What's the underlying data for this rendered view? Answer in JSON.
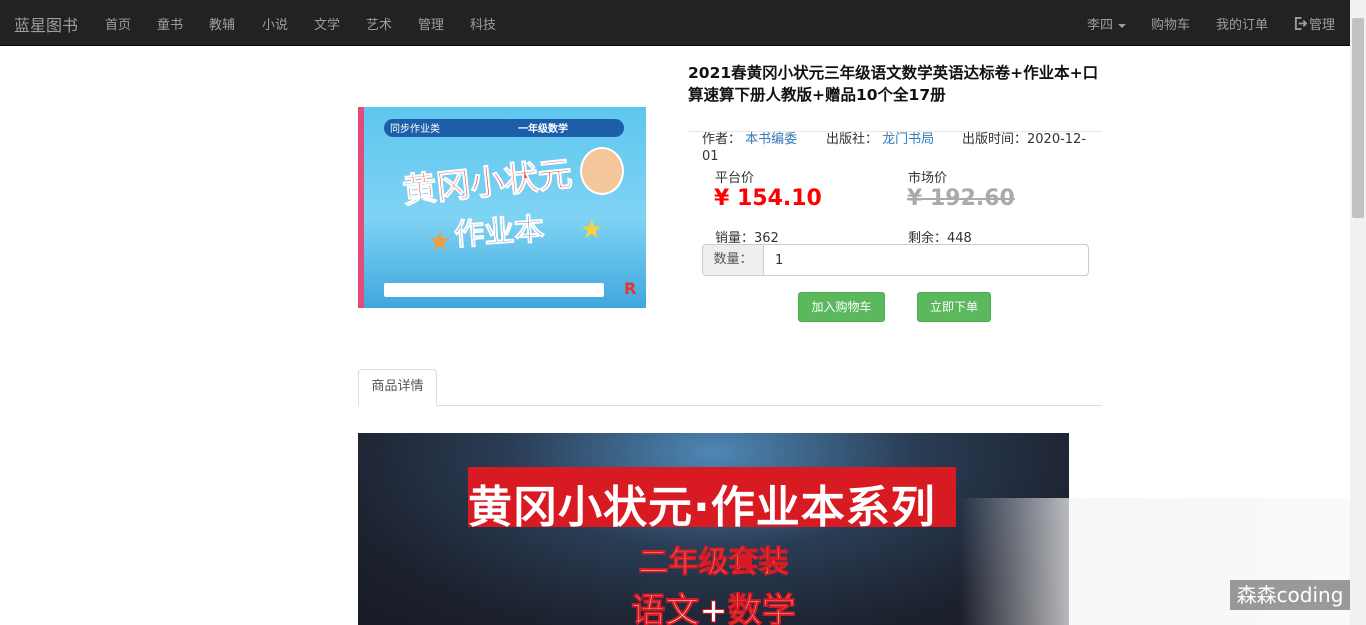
{
  "navbar": {
    "brand": "蓝星图书",
    "items": [
      {
        "label": "首页"
      },
      {
        "label": "童书"
      },
      {
        "label": "教辅"
      },
      {
        "label": "小说"
      },
      {
        "label": "文学"
      },
      {
        "label": "艺术"
      },
      {
        "label": "管理"
      },
      {
        "label": "科技"
      }
    ],
    "user": "李四",
    "cart": "购物车",
    "orders": "我的订单",
    "admin": "管理"
  },
  "product": {
    "title": "2021春黄冈小状元三年级语文数学英语达标卷+作业本+口算速算下册人教版+赠品10个全17册",
    "cover": {
      "series": "同步作业类",
      "grade_badge": "一年级数学",
      "line1": "黄冈小状元",
      "line2": "作业本",
      "edition_mark": "R"
    },
    "author_label": "作者：",
    "author": "本书编委",
    "publisher_label": "出版社：",
    "publisher": "龙门书局",
    "pubdate_label": "出版时间：",
    "pubdate": "2020-12-01",
    "platform_price_label": "平台价",
    "platform_price": "¥ 154.10",
    "market_price_label": "市场价",
    "market_price": "¥ 192.60",
    "sales_label": "销量：",
    "sales": "362",
    "stock_label": "剩余：",
    "stock": "448",
    "qty_label": "数量：",
    "qty_value": "1",
    "add_to_cart": "加入购物车",
    "buy_now": "立即下单"
  },
  "tabs": [
    {
      "label": "商品详情"
    }
  ],
  "detail_banner": {
    "headline": "黄冈小状元·作业本系列",
    "line2": "二年级套装",
    "line3": "语文+数学"
  },
  "watermark": "森森coding",
  "colors": {
    "navbar_bg": "#222222",
    "price_red": "#ff0000",
    "button_green": "#5cb85c",
    "link_blue": "#337ab7"
  }
}
